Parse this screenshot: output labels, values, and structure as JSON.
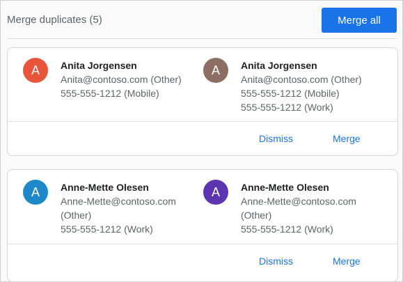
{
  "header": {
    "title": "Merge duplicates (5)",
    "merge_all_label": "Merge all"
  },
  "groups": [
    {
      "contacts": [
        {
          "initial": "A",
          "avatar_color": "#e8553a",
          "name": "Anita Jorgensen",
          "lines": [
            "Anita@contoso.com (Other)",
            "555-555-1212 (Mobile)"
          ]
        },
        {
          "initial": "A",
          "avatar_color": "#8d6e63",
          "name": "Anita Jorgensen",
          "lines": [
            "Anita@contoso.com (Other)",
            "555-555-1212 (Mobile)",
            "555-555-1212 (Work)"
          ]
        }
      ],
      "dismiss_label": "Dismiss",
      "merge_label": "Merge"
    },
    {
      "contacts": [
        {
          "initial": "A",
          "avatar_color": "#1e88c9",
          "name": "Anne-Mette Olesen",
          "lines": [
            "Anne-Mette@contoso.com",
            "(Other)",
            "555-555-1212 (Work)"
          ]
        },
        {
          "initial": "A",
          "avatar_color": "#5e35b1",
          "name": "Anne-Mette Olesen",
          "lines": [
            "Anne-Mette@contoso.com",
            "(Other)",
            "555-555-1212 (Work)"
          ]
        }
      ],
      "dismiss_label": "Dismiss",
      "merge_label": "Merge"
    }
  ]
}
